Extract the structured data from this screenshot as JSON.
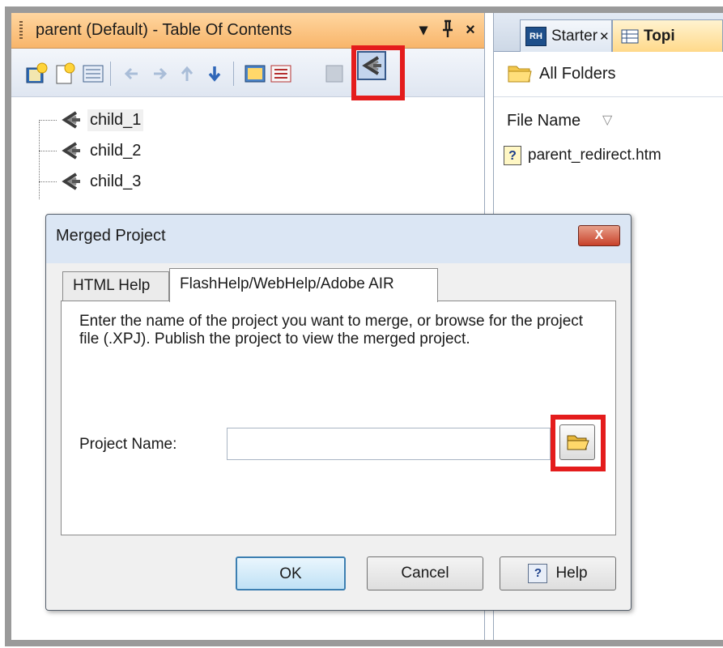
{
  "toc_pane": {
    "title": "parent (Default) - Table Of Contents",
    "title_buttons": {
      "dropdown": "▾",
      "pin": "ᵩ",
      "close": "×"
    },
    "tree_items": [
      {
        "label": "child_1",
        "selected": true
      },
      {
        "label": "child_2",
        "selected": false
      },
      {
        "label": "child_3",
        "selected": false
      }
    ]
  },
  "right_pane": {
    "tabs": [
      {
        "badge": "RH",
        "label": "Starter",
        "close": "✕"
      },
      {
        "label": "Topi"
      }
    ],
    "folder_label": "All Folders",
    "column_header": "File Name",
    "sort_indicator": "▽",
    "files": [
      {
        "icon": "?",
        "label": "parent_redirect.htm"
      }
    ]
  },
  "dialog": {
    "title": "Merged Project",
    "close_label": "X",
    "tabs": [
      {
        "label": "HTML Help",
        "active": false
      },
      {
        "label": "FlashHelp/WebHelp/Adobe AIR",
        "active": true
      }
    ],
    "description": "Enter the name of the project you want to merge, or browse for the project file (.XPJ). Publish the project to view the merged project.",
    "project_name_label": "Project Name:",
    "project_name_value": "",
    "buttons": {
      "ok": "OK",
      "cancel": "Cancel",
      "help_icon": "?",
      "help": "Help"
    }
  },
  "colors": {
    "highlight": "#e41c1c",
    "title_bar": "#f8b56a",
    "active_tab": "#ffd98a"
  }
}
